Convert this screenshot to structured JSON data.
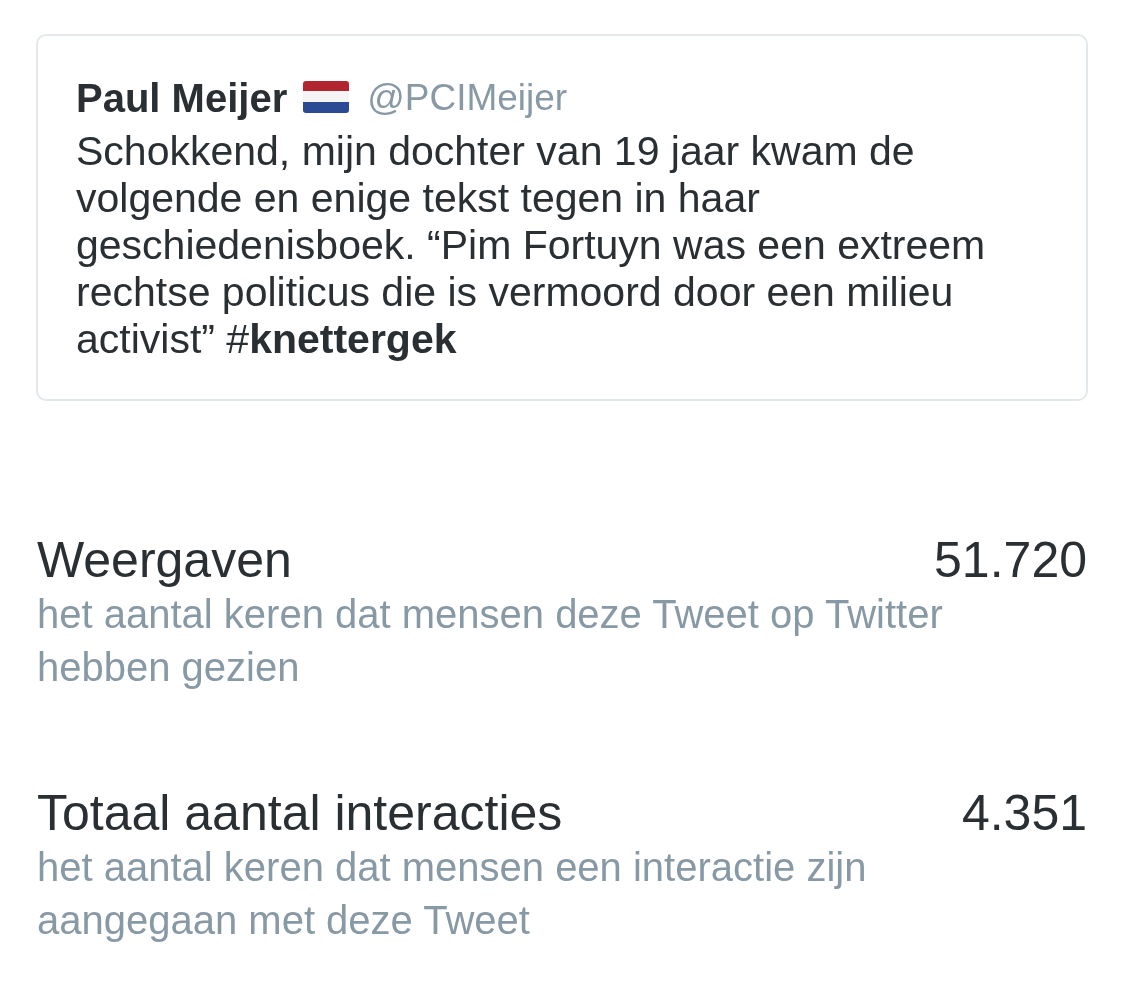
{
  "tweet": {
    "author_name": "Paul Meijer",
    "handle": "@PCIMeijer",
    "text": "Schokkend, mijn dochter van 19 jaar kwam de volgende en enige tekst tegen in haar geschiedenisboek. “Pim Fortuyn was een extreem rechtse politicus die is vermoord door een milieu activist” #**knettergek**"
  },
  "stats": [
    {
      "label": "Weergaven",
      "value": "51.720",
      "description": "het aantal keren dat mensen deze Tweet op Twitter hebben gezien"
    },
    {
      "label": "Totaal aantal interacties",
      "value": "4.351",
      "description": "het aantal keren dat mensen een interactie zijn aangegaan met deze Tweet"
    }
  ]
}
